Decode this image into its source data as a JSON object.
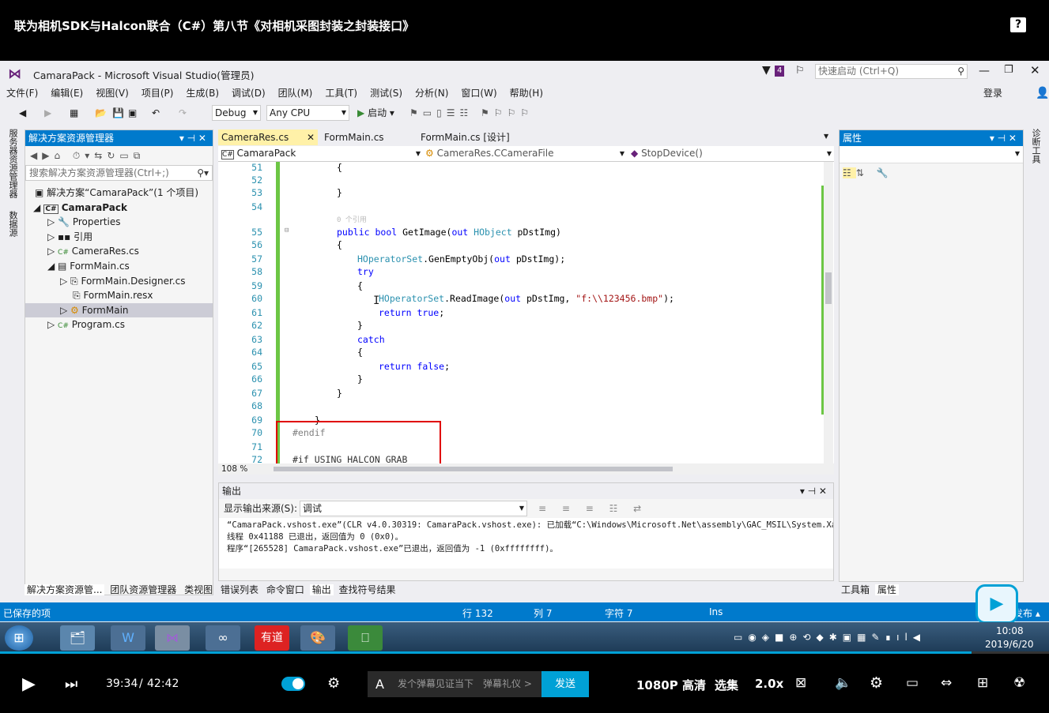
{
  "video": {
    "title": "联为相机SDK与Halcon联合（C#）第八节《对相机采图封装之封装接口》",
    "help": "?"
  },
  "vs": {
    "title": "CamaraPack - Microsoft Visual Studio(管理员)",
    "notif_count": "4",
    "quick_launch": "快速启动 (Ctrl+Q)",
    "login": "登录",
    "menu": [
      "文件(F)",
      "编辑(E)",
      "视图(V)",
      "项目(P)",
      "生成(B)",
      "调试(D)",
      "团队(M)",
      "工具(T)",
      "测试(S)",
      "分析(N)",
      "窗口(W)",
      "帮助(H)"
    ],
    "config": "Debug",
    "platform": "Any CPU",
    "start": "启动",
    "solution_explorer": {
      "title": "解决方案资源管理器",
      "search": "搜索解决方案资源管理器(Ctrl+;)",
      "items": [
        "解决方案“CamaraPack”(1 个项目)",
        "CamaraPack",
        "Properties",
        "引用",
        "CameraRes.cs",
        "FormMain.cs",
        "FormMain.Designer.cs",
        "FormMain.resx",
        "FormMain",
        "Program.cs"
      ],
      "bottom_tabs": [
        "解决方案资源管...",
        "团队资源管理器",
        "类视图"
      ]
    },
    "left_strip": [
      "服务器资源管理器",
      "数据源"
    ],
    "right_strip": "诊断工具",
    "editor": {
      "tabs": [
        "CameraRes.cs",
        "FormMain.cs",
        "FormMain.cs [设计]"
      ],
      "nav": [
        "CamaraPack",
        "CameraRes.CCameraFile",
        "StopDevice()"
      ],
      "zoom": "108 %",
      "line_numbers": [
        "51",
        "52",
        "53",
        "54",
        "55",
        "56",
        "57",
        "58",
        "59",
        "60",
        "61",
        "62",
        "63",
        "64",
        "65",
        "66",
        "67",
        "68",
        "69",
        "70",
        "71",
        "72"
      ],
      "lines": [
        "{",
        "",
        "}",
        "",
        "public bool GetImage(out HObject pDstImg)",
        "{",
        "HOperatorSet.GenEmptyObj(out pDstImg);",
        "try",
        "{",
        "HOperatorSet.ReadImage(out pDstImg, \"f:\\\\123456.bmp\");",
        "return true;",
        "}",
        "catch",
        "{",
        "return false;",
        "}",
        "}",
        "",
        "}",
        "#endif",
        "",
        "#if USING HALCON GRAB"
      ],
      "ref_hint": "0 个引用"
    },
    "output": {
      "title": "输出",
      "source_label": "显示输出来源(S):",
      "source": "调试",
      "lines": [
        "“CamaraPack.vshost.exe”(CLR v4.0.30319: CamaraPack.vshost.exe): 已加载“C:\\Windows\\Microsoft.Net\\assembly\\GAC_MSIL\\System.Xaml",
        "线程 0x41188 已退出，返回值为 0 (0x0)。",
        "程序“[265528] CamaraPack.vshost.exe”已退出，返回值为 -1 (0xffffffff)。"
      ],
      "bottom_tabs": [
        "错误列表",
        "命令窗口",
        "输出",
        "查找符号结果"
      ]
    },
    "properties": {
      "title": "属性",
      "bottom_tabs": [
        "工具箱",
        "属性"
      ]
    },
    "status": {
      "left": "已保存的项",
      "row": "行 132",
      "col": "列 7",
      "char": "字符 7",
      "mode": "Ins",
      "publish": "发布"
    }
  },
  "taskbar": {
    "time": "10:08",
    "date": "2019/6/20",
    "youdao": "有道"
  },
  "player": {
    "current": "39:34",
    "sep": "/",
    "total": "42:42",
    "danmaku_placeholder": "发个弹幕见证当下",
    "danmaku_etiquette": "弹幕礼仪 >",
    "send": "发送",
    "quality": "1080P 高清",
    "episodes": "选集",
    "speed": "2.0x"
  },
  "colors": {
    "accent": "#007acc",
    "highlight_box": "#e00000",
    "send": "#00a1d6"
  }
}
